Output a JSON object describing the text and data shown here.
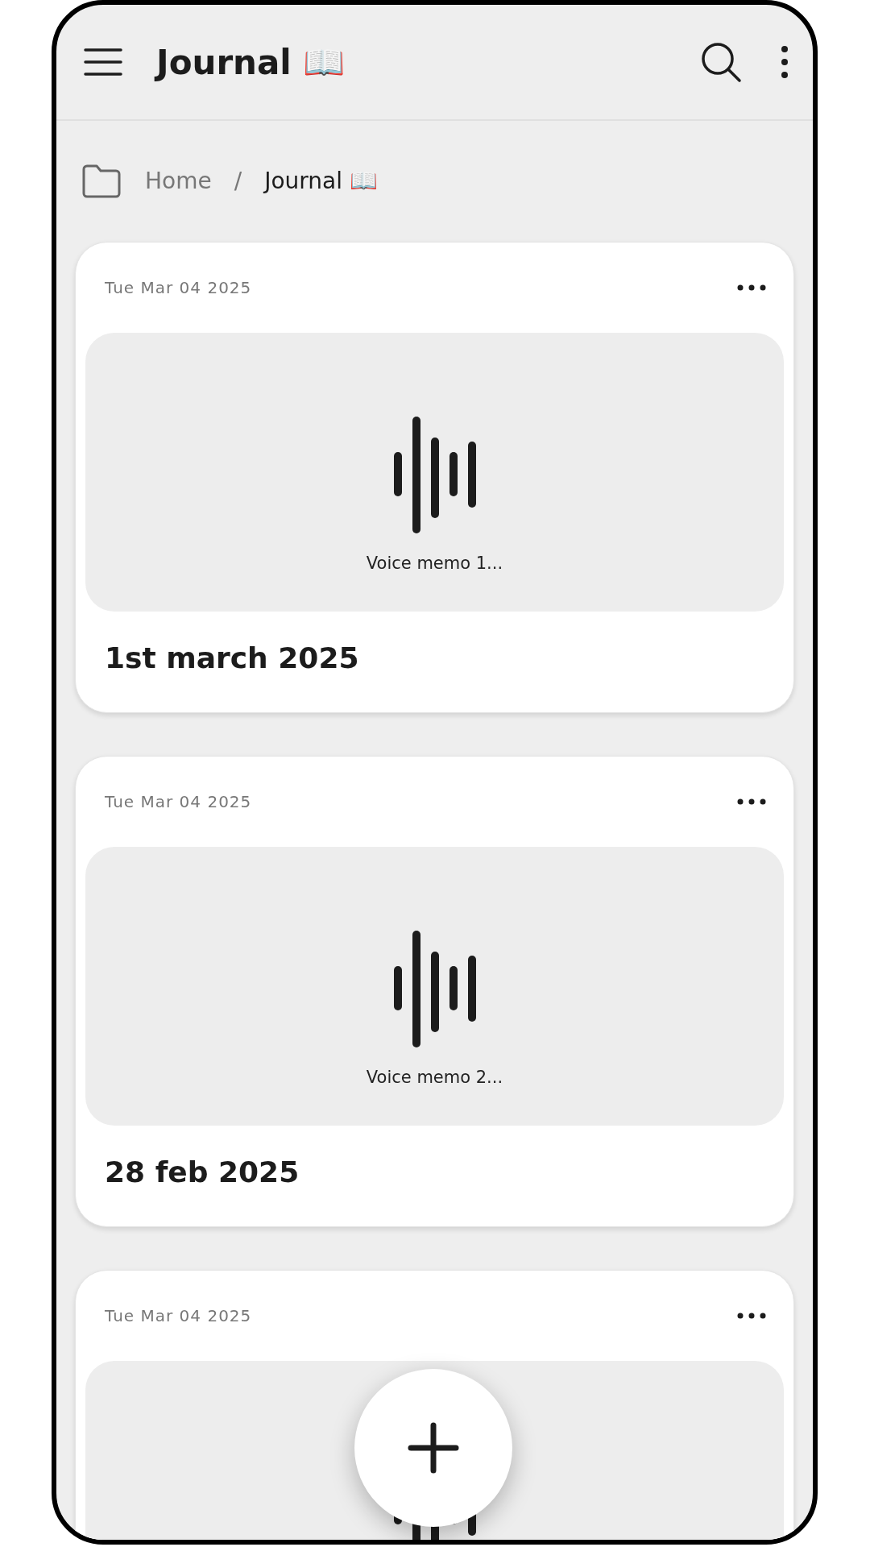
{
  "app_bar": {
    "title": "Journal 📖"
  },
  "breadcrumb": [
    {
      "label": "Home",
      "current": false
    },
    {
      "label": "Journal 📖",
      "current": true
    }
  ],
  "breadcrumb_separator": "/",
  "entries": [
    {
      "date": "Tue Mar 04 2025",
      "attachment": {
        "kind": "voice_memo",
        "caption": "Voice memo 1..."
      },
      "title": "1st march 2025"
    },
    {
      "date": "Tue Mar 04 2025",
      "attachment": {
        "kind": "voice_memo",
        "caption": "Voice memo 2..."
      },
      "title": "28 feb 2025"
    },
    {
      "date": "Tue Mar 04 2025",
      "attachment": {
        "kind": "voice_memo"
      }
    }
  ]
}
